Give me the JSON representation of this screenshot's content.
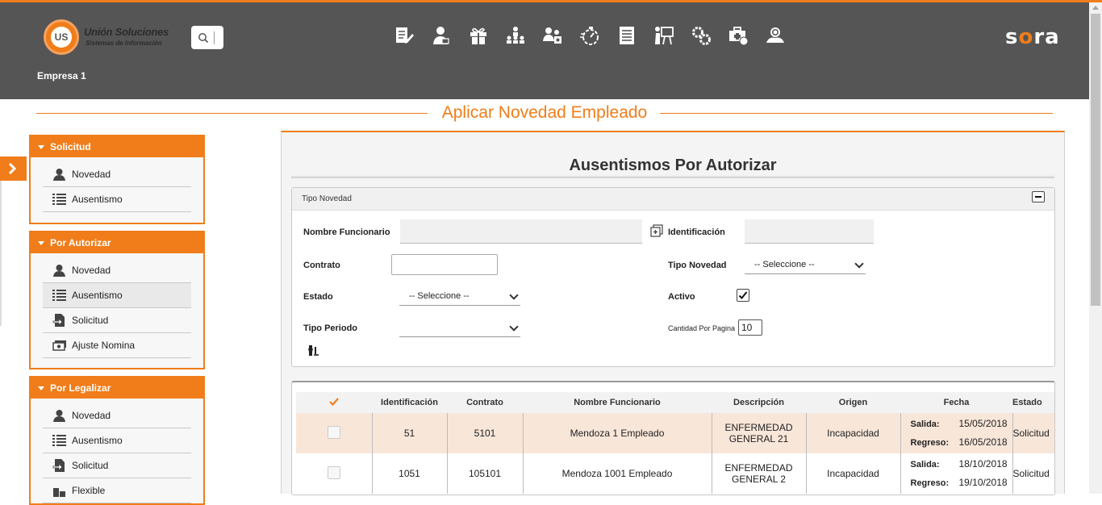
{
  "header": {
    "logo_name": "Unión Soluciones",
    "logo_sub": "Sistemas de Información",
    "logo_mark": "US",
    "brand_prefix": "s",
    "brand_accent": "o",
    "brand_suffix": "ra",
    "company": "Empresa 1",
    "toolbar_icons": [
      "document-edit-icon",
      "employee-icon",
      "gift-icon",
      "org-chart-icon",
      "people-settings-icon",
      "stopwatch-icon",
      "list-document-icon",
      "presentation-icon",
      "gears-icon",
      "medical-case-icon",
      "support-people-icon"
    ]
  },
  "page": {
    "title": "Aplicar Novedad Empleado"
  },
  "sidebar": {
    "panels": [
      {
        "title": "Solicitud",
        "items": [
          {
            "label": "Novedad",
            "icon": "person-icon"
          },
          {
            "label": "Ausentismo",
            "icon": "list-icon"
          }
        ]
      },
      {
        "title": "Por Autorizar",
        "items": [
          {
            "label": "Novedad",
            "icon": "person-icon"
          },
          {
            "label": "Ausentismo",
            "icon": "list-icon",
            "active": true
          },
          {
            "label": "Solicitud",
            "icon": "doc-arrow-icon"
          },
          {
            "label": "Ajuste Nomina",
            "icon": "money-icon"
          }
        ]
      },
      {
        "title": "Por Legalizar",
        "items": [
          {
            "label": "Novedad",
            "icon": "person-icon"
          },
          {
            "label": "Ausentismo",
            "icon": "list-icon"
          },
          {
            "label": "Solicitud",
            "icon": "doc-arrow-icon"
          },
          {
            "label": "Flexible",
            "icon": "flex-icon"
          }
        ]
      }
    ]
  },
  "main": {
    "subtitle": "Ausentismos Por Autorizar",
    "filters": {
      "header": "Tipo Novedad",
      "nombre_label": "Nombre Funcionario",
      "nombre_value": "",
      "identificacion_label": "Identificación",
      "identificacion_value": "",
      "contrato_label": "Contrato",
      "contrato_value": "",
      "tipo_novedad_label": "Tipo Novedad",
      "tipo_novedad_value": "-- Seleccione --",
      "estado_label": "Estado",
      "estado_value": "-- Seleccione --",
      "activo_label": "Activo",
      "activo_checked": true,
      "tipo_periodo_label": "Tipo Periodo",
      "tipo_periodo_value": "",
      "cantidad_label": "Cantidad Por Pagina",
      "cantidad_value": "10"
    },
    "table": {
      "columns": [
        "",
        "Identificación",
        "Contrato",
        "Nombre Funcionario",
        "Descripción",
        "Origen",
        "Fecha",
        "Estado"
      ],
      "salida_label": "Salida:",
      "regreso_label": "Regreso:",
      "rows": [
        {
          "identificacion": "51",
          "contrato": "5101",
          "nombre": "Mendoza 1 Empleado",
          "descripcion_1": "ENFERMEDAD",
          "descripcion_2": "GENERAL 21",
          "origen": "Incapacidad",
          "salida": "15/05/2018",
          "regreso": "16/05/2018",
          "estado": "Solicitud"
        },
        {
          "identificacion": "1051",
          "contrato": "105101",
          "nombre": "Mendoza 1001 Empleado",
          "descripcion_1": "ENFERMEDAD",
          "descripcion_2": "GENERAL 2",
          "origen": "Incapacidad",
          "salida": "18/10/2018",
          "regreso": "19/10/2018",
          "estado": "Solicitud"
        }
      ]
    }
  },
  "colors": {
    "accent": "#f07d1a",
    "header_bg": "#555555",
    "row_highlight": "#f8e6d9"
  }
}
